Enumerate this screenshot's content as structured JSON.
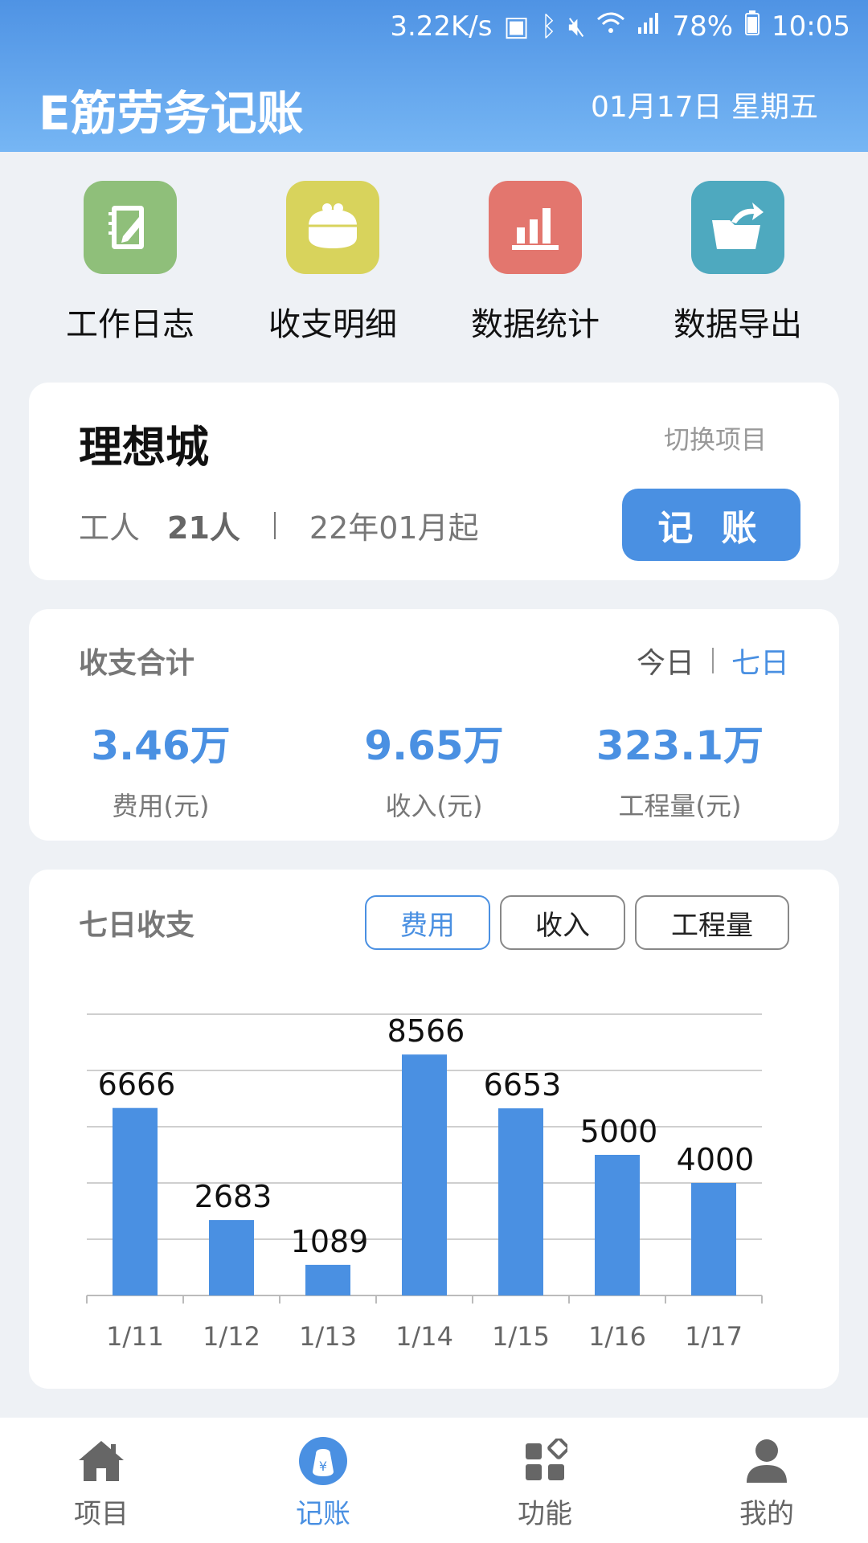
{
  "status_bar": {
    "speed": "3.22K/s",
    "battery": "78%",
    "time": "10:05"
  },
  "header": {
    "title": "E筋劳务记账",
    "date": "01月17日 星期五"
  },
  "quick_actions": [
    {
      "label": "工作日志",
      "icon": "notebook-pen-icon",
      "color": "#8fbf7a"
    },
    {
      "label": "收支明细",
      "icon": "coin-purse-icon",
      "color": "#d8d35c"
    },
    {
      "label": "数据统计",
      "icon": "bar-chart-icon",
      "color": "#e3766e"
    },
    {
      "label": "数据导出",
      "icon": "folder-export-icon",
      "color": "#4ea9bf"
    }
  ],
  "project": {
    "name": "理想城",
    "switch_label": "切换项目",
    "workers_label": "工人",
    "workers_value": "21人",
    "start": "22年01月起",
    "record_button": "记 账"
  },
  "summary": {
    "title": "收支合计",
    "range_today": "今日",
    "range_week": "七日",
    "stats": [
      {
        "value": "3.46万",
        "label": "费用(元)"
      },
      {
        "value": "9.65万",
        "label": "收入(元)"
      },
      {
        "value": "323.1万",
        "label": "工程量(元)"
      }
    ]
  },
  "chart_card": {
    "title": "七日收支",
    "tabs": [
      "费用",
      "收入",
      "工程量"
    ],
    "active_tab": "费用"
  },
  "chart_data": {
    "type": "bar",
    "categories": [
      "1/11",
      "1/12",
      "1/13",
      "1/14",
      "1/15",
      "1/16",
      "1/17"
    ],
    "values": [
      6666,
      2683,
      1089,
      8566,
      6653,
      5000,
      4000
    ],
    "title": "",
    "xlabel": "",
    "ylabel": "",
    "ylim": [
      0,
      10000
    ],
    "grid": true,
    "bar_color": "#4a90e2"
  },
  "bottom_nav": [
    {
      "label": "项目",
      "icon": "home-icon"
    },
    {
      "label": "记账",
      "icon": "yen-bag-icon",
      "active": true
    },
    {
      "label": "功能",
      "icon": "apps-grid-icon"
    },
    {
      "label": "我的",
      "icon": "user-icon"
    }
  ],
  "colors": {
    "accent": "#4a90e2",
    "header_top": "#4f93e4",
    "header_bottom": "#76b6f4"
  }
}
